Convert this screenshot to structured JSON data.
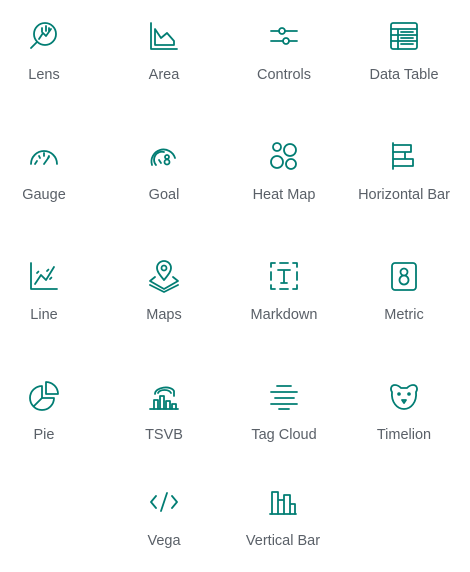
{
  "visualizations": [
    {
      "label": "Lens",
      "icon": "lens-icon"
    },
    {
      "label": "Area",
      "icon": "area-chart-icon"
    },
    {
      "label": "Controls",
      "icon": "controls-icon"
    },
    {
      "label": "Data Table",
      "icon": "data-table-icon"
    },
    {
      "label": "Gauge",
      "icon": "gauge-icon"
    },
    {
      "label": "Goal",
      "icon": "goal-icon"
    },
    {
      "label": "Heat Map",
      "icon": "heat-map-icon"
    },
    {
      "label": "Horizontal Bar",
      "icon": "horizontal-bar-icon"
    },
    {
      "label": "Line",
      "icon": "line-chart-icon"
    },
    {
      "label": "Maps",
      "icon": "maps-icon"
    },
    {
      "label": "Markdown",
      "icon": "markdown-icon"
    },
    {
      "label": "Metric",
      "icon": "metric-icon"
    },
    {
      "label": "Pie",
      "icon": "pie-chart-icon"
    },
    {
      "label": "TSVB",
      "icon": "tsvb-icon"
    },
    {
      "label": "Tag Cloud",
      "icon": "tag-cloud-icon"
    },
    {
      "label": "Timelion",
      "icon": "timelion-icon"
    },
    {
      "label": "Vega",
      "icon": "vega-icon"
    },
    {
      "label": "Vertical Bar",
      "icon": "vertical-bar-icon"
    }
  ],
  "colors": {
    "accent": "#017d73",
    "label": "#5a6068",
    "background": "#ffffff"
  }
}
